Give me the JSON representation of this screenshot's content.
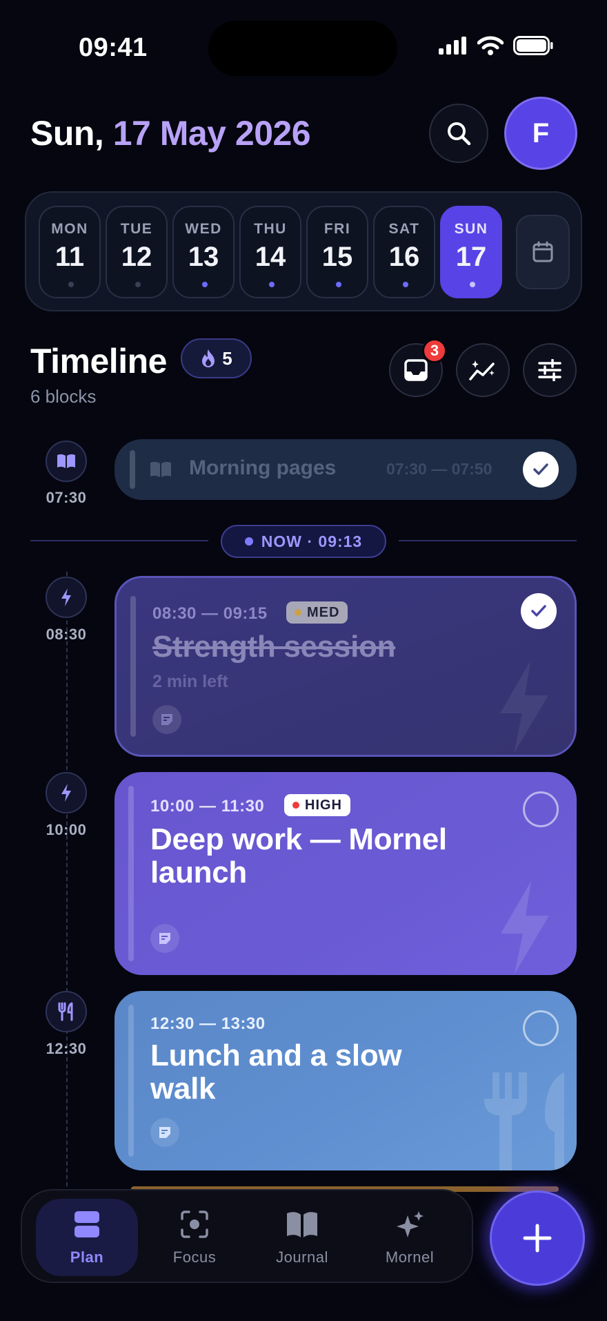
{
  "status_bar": {
    "time": "09:41"
  },
  "header": {
    "day_prefix": "Sun, ",
    "date_accent": "17 May 2026",
    "avatar_initial": "F"
  },
  "week": [
    {
      "name": "MON",
      "num": "11",
      "dot": "#3a3f55"
    },
    {
      "name": "TUE",
      "num": "12",
      "dot": "#3a3f55"
    },
    {
      "name": "WED",
      "num": "13",
      "dot": "#6e6bff"
    },
    {
      "name": "THU",
      "num": "14",
      "dot": "#6e6bff"
    },
    {
      "name": "FRI",
      "num": "15",
      "dot": "#6e6bff"
    },
    {
      "name": "SAT",
      "num": "16",
      "dot": "#6e6bff"
    },
    {
      "name": "SUN",
      "num": "17",
      "dot": "#c9c2ff",
      "active": true
    }
  ],
  "timeline": {
    "title": "Timeline",
    "streak": "5",
    "subtitle": "6 blocks",
    "inbox_badge": "3",
    "now_label": "NOW · 09:13"
  },
  "blocks": [
    {
      "rail_time": "07:30",
      "icon": "book-icon",
      "title": "Morning pages",
      "range": "07:30 — 07:50",
      "done": true
    },
    {
      "rail_time": "08:30",
      "icon": "bolt-icon",
      "range": "08:30 — 09:15",
      "priority": "MED",
      "priority_color": "#c9a24a",
      "title": "Strength session",
      "meta": "2 min left",
      "done": true
    },
    {
      "rail_time": "10:00",
      "icon": "bolt-icon",
      "range": "10:00 — 11:30",
      "priority": "HIGH",
      "priority_color": "#ef3b3b",
      "title_line1": "Deep work — Mornel",
      "title_line2": "launch",
      "done": false
    },
    {
      "rail_time": "12:30",
      "icon": "fork-knife-icon",
      "range": "12:30 — 13:30",
      "title_line1": "Lunch and a slow",
      "title_line2": "walk",
      "done": false
    }
  ],
  "nav": [
    {
      "label": "Plan",
      "icon": "plan-icon",
      "active": true
    },
    {
      "label": "Focus",
      "icon": "focus-icon"
    },
    {
      "label": "Journal",
      "icon": "journal-icon"
    },
    {
      "label": "Mornel",
      "icon": "sparkle-icon"
    }
  ],
  "colors": {
    "accent": "#5843e6",
    "accent_text": "#b8a2f7",
    "background": "#05060f",
    "deep_work_card": "#6a5bd4",
    "lunch_card": "#5f8fd0"
  }
}
